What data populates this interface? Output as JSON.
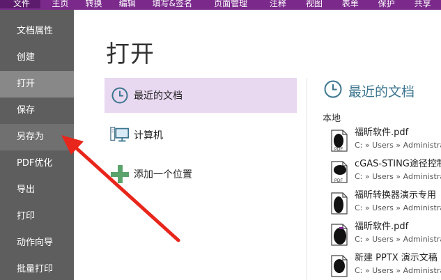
{
  "ribbon": {
    "tabs": [
      {
        "label": "文件"
      },
      {
        "label": "主页"
      },
      {
        "label": "转换"
      },
      {
        "label": "编辑"
      },
      {
        "label": "填写&签名"
      },
      {
        "label": "页面管理"
      },
      {
        "label": "注释"
      },
      {
        "label": "视图"
      },
      {
        "label": "表单"
      },
      {
        "label": "保护"
      },
      {
        "label": "共享"
      }
    ]
  },
  "sidebar": {
    "items": [
      {
        "label": "文档属性"
      },
      {
        "label": "创建"
      },
      {
        "label": "打开"
      },
      {
        "label": "保存"
      },
      {
        "label": "另存为"
      },
      {
        "label": "PDF优化"
      },
      {
        "label": "导出"
      },
      {
        "label": "打印"
      },
      {
        "label": "动作向导"
      },
      {
        "label": "批量打印"
      }
    ]
  },
  "main": {
    "title": "打开",
    "options": [
      {
        "label": "最近的文档",
        "icon": "clock-icon"
      },
      {
        "label": "计算机",
        "icon": "computer-icon"
      },
      {
        "label": "添加一个位置",
        "icon": "plus-icon"
      }
    ]
  },
  "recent": {
    "title": "最近的文档",
    "local_label": "本地",
    "files": [
      {
        "name": "福昕软件.pdf",
        "path": "C: » Users » Administrat"
      },
      {
        "name": "cGAS-STING途径控制",
        "path": "C: » Users » Administrat"
      },
      {
        "name": "福昕转换器演示专用",
        "path": "C: » Users » Administrat"
      },
      {
        "name": "福昕软件.pdf",
        "path": "C: » Users » Administrat"
      },
      {
        "name": "新建 PPTX 演示文稿",
        "path": "C: » Users » Administrat"
      }
    ]
  },
  "colors": {
    "ribbon": "#7b2a8c",
    "sidebar": "#5e5e5e",
    "selected_option": "#e8d8f0",
    "accent": "#3c7690",
    "annotation_arrow": "#e8261c"
  }
}
